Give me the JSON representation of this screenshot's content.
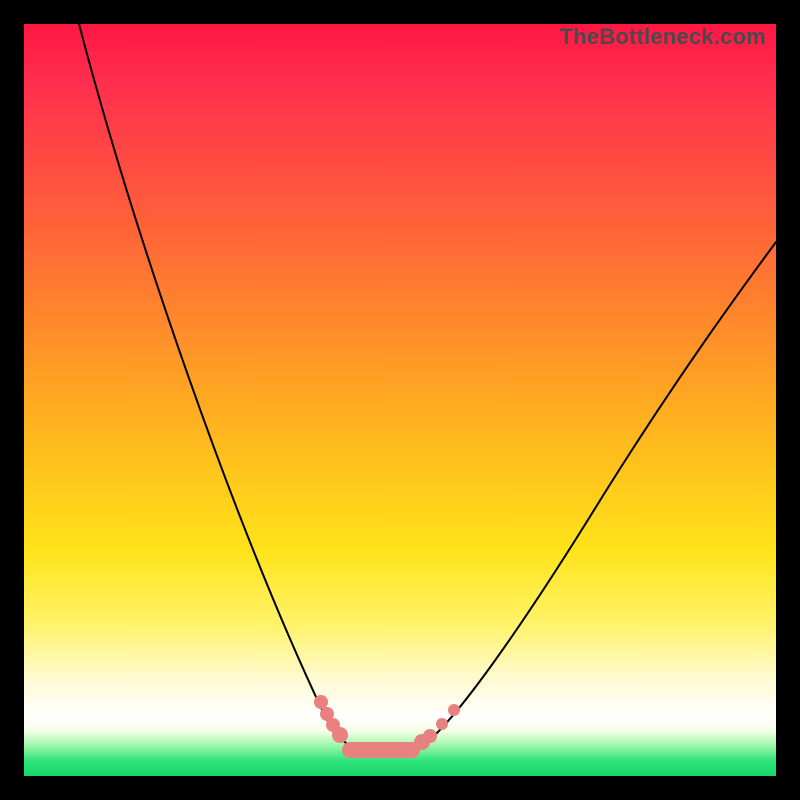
{
  "watermark": "TheBottleneck.com",
  "colors": {
    "frame": "#000000",
    "curve": "#000000",
    "markers": "#e98181",
    "gradient_top": "#ff1744",
    "gradient_bottom": "#17d968"
  },
  "chart_data": {
    "type": "line",
    "title": "",
    "xlabel": "",
    "ylabel": "",
    "xlim": [
      0,
      100
    ],
    "ylim": [
      0,
      100
    ],
    "series": [
      {
        "name": "bottleneck-curve",
        "x": [
          7,
          10,
          15,
          20,
          25,
          30,
          35,
          38,
          40,
          42,
          45,
          48,
          50,
          52,
          55,
          60,
          65,
          70,
          75,
          80,
          85,
          90,
          95,
          100
        ],
        "values": [
          100,
          90,
          74,
          59,
          45,
          32,
          20,
          13,
          8,
          5,
          2,
          1,
          2,
          3,
          6,
          13,
          21,
          30,
          38,
          46,
          53,
          60,
          66,
          71
        ]
      }
    ],
    "annotations": {
      "left_marker_x": 40,
      "right_marker_x": 53,
      "valley_range_x": [
        42,
        51
      ]
    }
  }
}
